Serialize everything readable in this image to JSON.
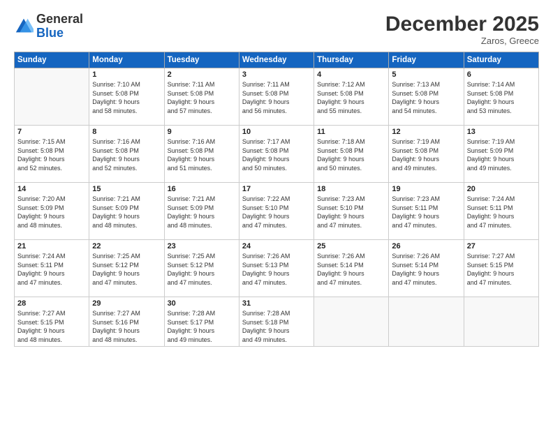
{
  "logo": {
    "text_general": "General",
    "text_blue": "Blue"
  },
  "header": {
    "month": "December 2025",
    "location": "Zaros, Greece"
  },
  "days_of_week": [
    "Sunday",
    "Monday",
    "Tuesday",
    "Wednesday",
    "Thursday",
    "Friday",
    "Saturday"
  ],
  "weeks": [
    [
      {
        "day": "",
        "info": ""
      },
      {
        "day": "1",
        "info": "Sunrise: 7:10 AM\nSunset: 5:08 PM\nDaylight: 9 hours\nand 58 minutes."
      },
      {
        "day": "2",
        "info": "Sunrise: 7:11 AM\nSunset: 5:08 PM\nDaylight: 9 hours\nand 57 minutes."
      },
      {
        "day": "3",
        "info": "Sunrise: 7:11 AM\nSunset: 5:08 PM\nDaylight: 9 hours\nand 56 minutes."
      },
      {
        "day": "4",
        "info": "Sunrise: 7:12 AM\nSunset: 5:08 PM\nDaylight: 9 hours\nand 55 minutes."
      },
      {
        "day": "5",
        "info": "Sunrise: 7:13 AM\nSunset: 5:08 PM\nDaylight: 9 hours\nand 54 minutes."
      },
      {
        "day": "6",
        "info": "Sunrise: 7:14 AM\nSunset: 5:08 PM\nDaylight: 9 hours\nand 53 minutes."
      }
    ],
    [
      {
        "day": "7",
        "info": "Sunrise: 7:15 AM\nSunset: 5:08 PM\nDaylight: 9 hours\nand 52 minutes."
      },
      {
        "day": "8",
        "info": "Sunrise: 7:16 AM\nSunset: 5:08 PM\nDaylight: 9 hours\nand 52 minutes."
      },
      {
        "day": "9",
        "info": "Sunrise: 7:16 AM\nSunset: 5:08 PM\nDaylight: 9 hours\nand 51 minutes."
      },
      {
        "day": "10",
        "info": "Sunrise: 7:17 AM\nSunset: 5:08 PM\nDaylight: 9 hours\nand 50 minutes."
      },
      {
        "day": "11",
        "info": "Sunrise: 7:18 AM\nSunset: 5:08 PM\nDaylight: 9 hours\nand 50 minutes."
      },
      {
        "day": "12",
        "info": "Sunrise: 7:19 AM\nSunset: 5:08 PM\nDaylight: 9 hours\nand 49 minutes."
      },
      {
        "day": "13",
        "info": "Sunrise: 7:19 AM\nSunset: 5:09 PM\nDaylight: 9 hours\nand 49 minutes."
      }
    ],
    [
      {
        "day": "14",
        "info": "Sunrise: 7:20 AM\nSunset: 5:09 PM\nDaylight: 9 hours\nand 48 minutes."
      },
      {
        "day": "15",
        "info": "Sunrise: 7:21 AM\nSunset: 5:09 PM\nDaylight: 9 hours\nand 48 minutes."
      },
      {
        "day": "16",
        "info": "Sunrise: 7:21 AM\nSunset: 5:09 PM\nDaylight: 9 hours\nand 48 minutes."
      },
      {
        "day": "17",
        "info": "Sunrise: 7:22 AM\nSunset: 5:10 PM\nDaylight: 9 hours\nand 47 minutes."
      },
      {
        "day": "18",
        "info": "Sunrise: 7:23 AM\nSunset: 5:10 PM\nDaylight: 9 hours\nand 47 minutes."
      },
      {
        "day": "19",
        "info": "Sunrise: 7:23 AM\nSunset: 5:11 PM\nDaylight: 9 hours\nand 47 minutes."
      },
      {
        "day": "20",
        "info": "Sunrise: 7:24 AM\nSunset: 5:11 PM\nDaylight: 9 hours\nand 47 minutes."
      }
    ],
    [
      {
        "day": "21",
        "info": "Sunrise: 7:24 AM\nSunset: 5:11 PM\nDaylight: 9 hours\nand 47 minutes."
      },
      {
        "day": "22",
        "info": "Sunrise: 7:25 AM\nSunset: 5:12 PM\nDaylight: 9 hours\nand 47 minutes."
      },
      {
        "day": "23",
        "info": "Sunrise: 7:25 AM\nSunset: 5:12 PM\nDaylight: 9 hours\nand 47 minutes."
      },
      {
        "day": "24",
        "info": "Sunrise: 7:26 AM\nSunset: 5:13 PM\nDaylight: 9 hours\nand 47 minutes."
      },
      {
        "day": "25",
        "info": "Sunrise: 7:26 AM\nSunset: 5:14 PM\nDaylight: 9 hours\nand 47 minutes."
      },
      {
        "day": "26",
        "info": "Sunrise: 7:26 AM\nSunset: 5:14 PM\nDaylight: 9 hours\nand 47 minutes."
      },
      {
        "day": "27",
        "info": "Sunrise: 7:27 AM\nSunset: 5:15 PM\nDaylight: 9 hours\nand 47 minutes."
      }
    ],
    [
      {
        "day": "28",
        "info": "Sunrise: 7:27 AM\nSunset: 5:15 PM\nDaylight: 9 hours\nand 48 minutes."
      },
      {
        "day": "29",
        "info": "Sunrise: 7:27 AM\nSunset: 5:16 PM\nDaylight: 9 hours\nand 48 minutes."
      },
      {
        "day": "30",
        "info": "Sunrise: 7:28 AM\nSunset: 5:17 PM\nDaylight: 9 hours\nand 49 minutes."
      },
      {
        "day": "31",
        "info": "Sunrise: 7:28 AM\nSunset: 5:18 PM\nDaylight: 9 hours\nand 49 minutes."
      },
      {
        "day": "",
        "info": ""
      },
      {
        "day": "",
        "info": ""
      },
      {
        "day": "",
        "info": ""
      }
    ]
  ]
}
